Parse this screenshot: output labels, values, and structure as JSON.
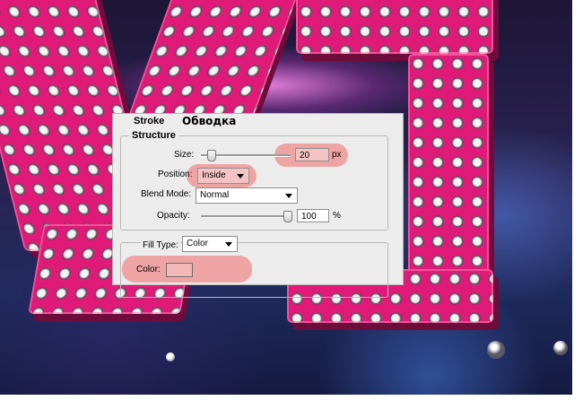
{
  "overlay_caption": "Обводка",
  "dialog": {
    "section_title": "Stroke",
    "structure": {
      "title": "Structure",
      "size": {
        "label": "Size:",
        "value": "20",
        "unit": "px",
        "slider_fraction": 0.07
      },
      "position": {
        "label": "Position:",
        "selected": "Inside"
      },
      "blend_mode": {
        "label": "Blend Mode:",
        "selected": "Normal"
      },
      "opacity": {
        "label": "Opacity:",
        "value": "100",
        "unit": "%",
        "slider_fraction": 1.0
      }
    },
    "fill": {
      "type_label": "Fill Type:",
      "type_selected": "Color",
      "color_label": "Color:",
      "color_value": "#f3b7b6"
    }
  },
  "highlight_color": "#f08c8c"
}
